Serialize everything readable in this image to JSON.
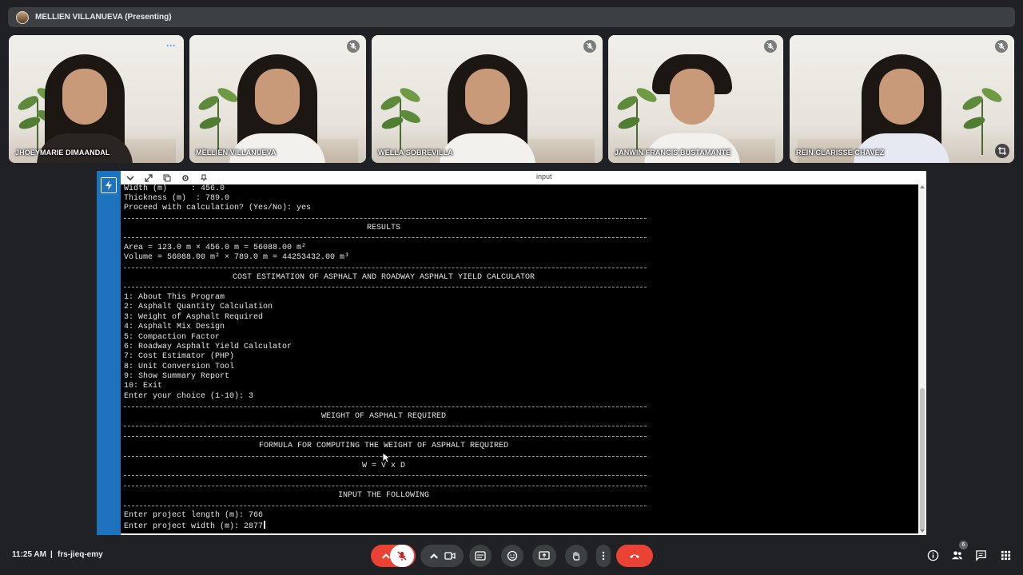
{
  "presenting": {
    "label": "MELLIEN VILLANUEVA (Presenting)"
  },
  "participants": [
    {
      "name": "JHOEYMARIE DIMAANDAL"
    },
    {
      "name": "MELLIEN VILLANUEVA"
    },
    {
      "name": "WELLA SOBREVILLA"
    },
    {
      "name": "JANWIN FRANCIS BUSTAMANTE"
    },
    {
      "name": "REIN CLARISSE CHAVEZ"
    }
  ],
  "screen": {
    "toolbar_title": "input",
    "lines": {
      "width": "Width (m)     : 456.0",
      "thickness": "Thickness (m)  : 789.0",
      "proceed": "Proceed with calculation? (Yes/No): yes",
      "results": "RESULTS",
      "area": "Area = 123.0 m × 456.0 m = 56088.00 m²",
      "volume": "Volume = 56088.00 m² × 789.0 m = 44253432.00 m³",
      "cost_title": "COST ESTIMATION OF ASPHALT AND ROADWAY ASPHALT YIELD CALCULATOR",
      "menu": [
        "1: About This Program",
        "2: Asphalt Quantity Calculation",
        "3: Weight of Asphalt Required",
        "4: Asphalt Mix Design",
        "5: Compaction Factor",
        "6: Roadway Asphalt Yield Calculator",
        "7: Cost Estimator (PHP)",
        "8: Unit Conversion Tool",
        "9: Show Summary Report",
        "10: Exit"
      ],
      "choice": "Enter your choice (1-10): 3",
      "weight_title": "WEIGHT OF ASPHALT REQUIRED",
      "formula_title": "FORMULA FOR COMPUTING THE WEIGHT OF ASPHALT REQUIRED",
      "formula": "W = V x D",
      "input_title": "INPUT THE FOLLOWING",
      "length": "Enter project length (m): 766",
      "width_input": "Enter project width (m): 2877"
    }
  },
  "bottom": {
    "time": "11:25 AM",
    "separator": "|",
    "meeting_code": "frs-jieq-emy",
    "participant_count": "6"
  },
  "colors": {
    "end_call": "#ea4335",
    "mic_off": "#ea4335",
    "accent": "#1e73be"
  }
}
